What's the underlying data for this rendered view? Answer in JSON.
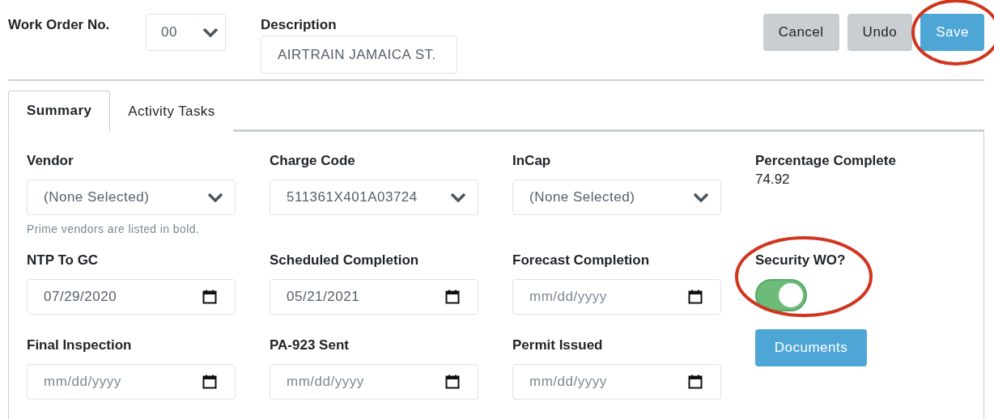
{
  "header": {
    "work_order": {
      "label": "Work Order No.",
      "value": "00"
    },
    "description": {
      "label": "Description",
      "value": "AIRTRAIN JAMAICA ST."
    },
    "buttons": [
      {
        "label": "Cancel",
        "kind": "secondary",
        "circled": false
      },
      {
        "label": "Undo",
        "kind": "secondary",
        "circled": false
      },
      {
        "label": "Save",
        "kind": "primary",
        "circled": true
      }
    ]
  },
  "tabs": [
    {
      "label": "Summary",
      "selected": true
    },
    {
      "label": "Activity Tasks",
      "selected": false
    }
  ],
  "fields": [
    {
      "kind": "select",
      "label": "Vendor",
      "value": "(None Selected)",
      "help": "Prime vendors are listed in bold."
    },
    {
      "kind": "select",
      "label": "Charge Code",
      "value": "511361X401A03724"
    },
    {
      "kind": "select",
      "label": "InCap",
      "value": "(None Selected)"
    },
    {
      "kind": "readout",
      "label": "Percentage Complete",
      "value": "74.92"
    },
    {
      "kind": "date",
      "label": "NTP To GC",
      "value": "07/29/2020"
    },
    {
      "kind": "date",
      "label": "Scheduled Completion",
      "value": "05/21/2021"
    },
    {
      "kind": "date",
      "label": "Forecast Completion",
      "placeholder": "mm/dd/yyyy"
    },
    {
      "kind": "toggle",
      "label": "Security WO?",
      "on": true,
      "circled": true
    },
    {
      "kind": "date",
      "label": "Final Inspection",
      "placeholder": "mm/dd/yyyy"
    },
    {
      "kind": "date",
      "label": "PA-923 Sent",
      "placeholder": "mm/dd/yyyy"
    },
    {
      "kind": "date",
      "label": "Permit Issued",
      "placeholder": "mm/dd/yyyy"
    },
    {
      "kind": "button",
      "label": "Documents"
    }
  ]
}
